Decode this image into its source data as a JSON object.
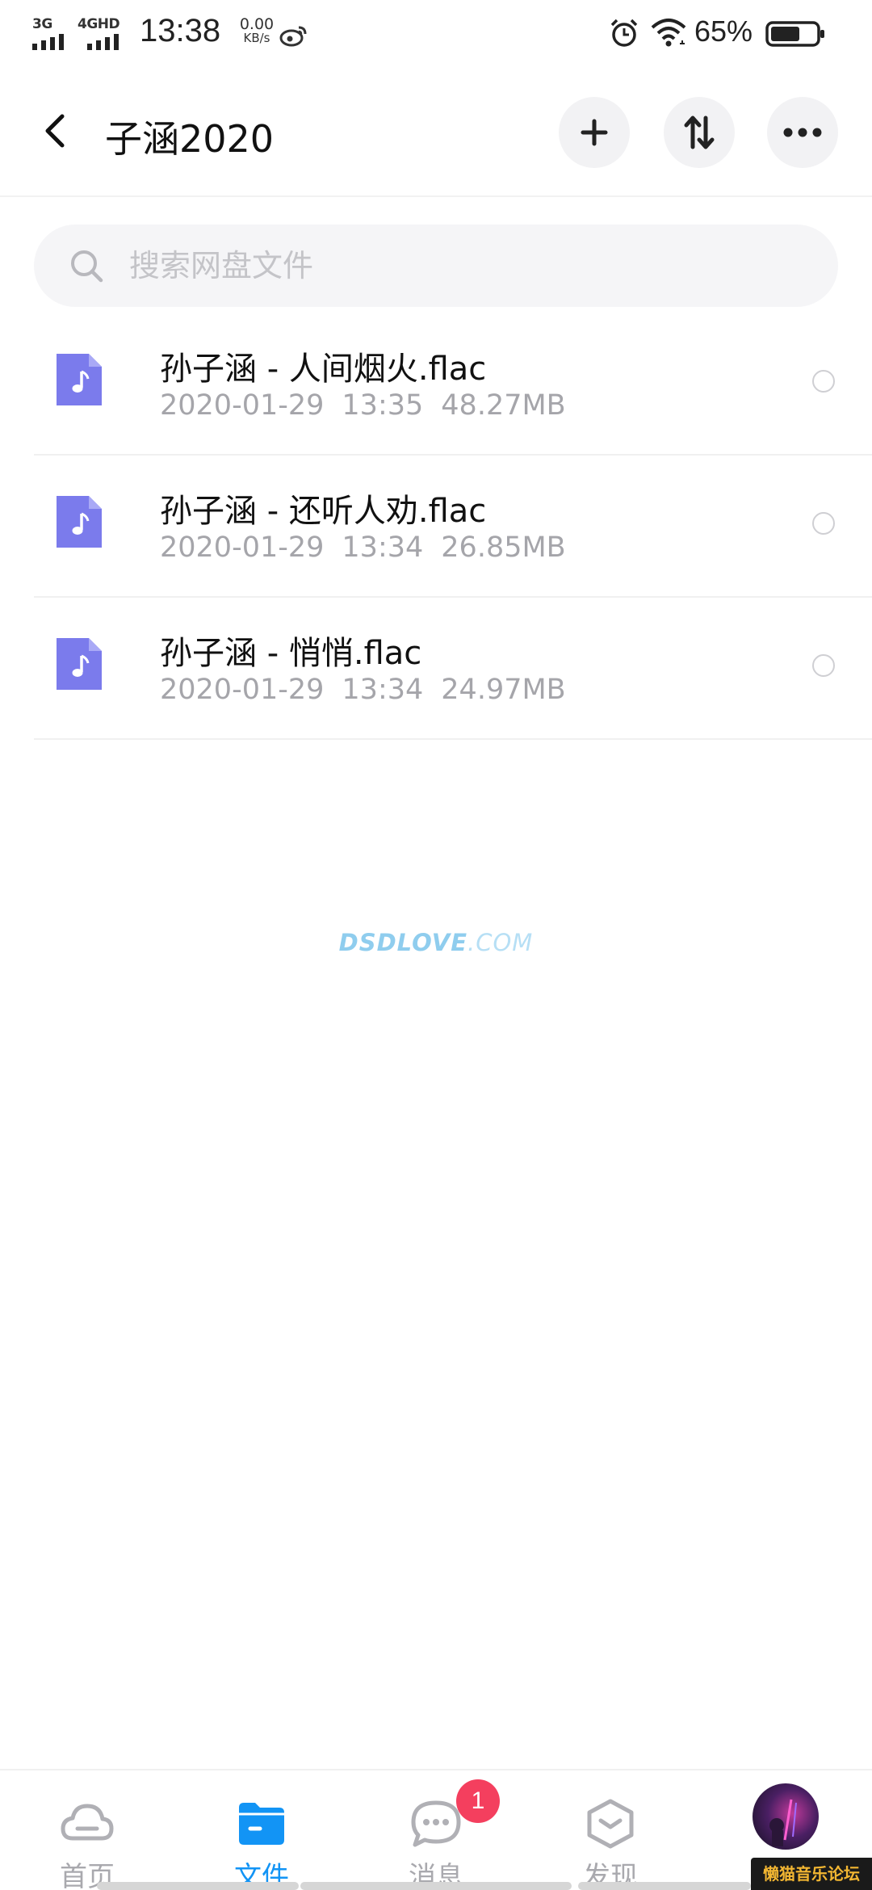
{
  "status_bar": {
    "network1": "3G",
    "network2": "4GHD",
    "time": "13:38",
    "net_speed_value": "0.00",
    "net_speed_unit": "KB/s",
    "battery_percent": "65%",
    "battery_level": 0.65
  },
  "header": {
    "title": "子涵2020"
  },
  "search": {
    "placeholder": "搜索网盘文件",
    "value": ""
  },
  "files": [
    {
      "name": "孙子涵 - 人间烟火.flac",
      "date": "2020-01-29",
      "time": "13:35",
      "size": "48.27MB"
    },
    {
      "name": "孙子涵 - 还听人劝.flac",
      "date": "2020-01-29",
      "time": "13:34",
      "size": "26.85MB"
    },
    {
      "name": "孙子涵 - 悄悄.flac",
      "date": "2020-01-29",
      "time": "13:34",
      "size": "24.97MB"
    }
  ],
  "watermark": {
    "main": "DSDLOVE",
    "suffix": ".COM"
  },
  "tabs": [
    {
      "label": "首页",
      "icon": "cloud-icon"
    },
    {
      "label": "文件",
      "icon": "folder-icon",
      "active": true
    },
    {
      "label": "消息",
      "icon": "chat-bubble-icon",
      "badge": "1"
    },
    {
      "label": "发现",
      "icon": "discover-hexagon-icon"
    }
  ],
  "corner_logo": "懒猫音乐论坛",
  "colors": {
    "accent": "#1294f5",
    "file_icon": "#7b7bec",
    "badge": "#f43f5e",
    "muted_text": "#a5a5aa"
  }
}
